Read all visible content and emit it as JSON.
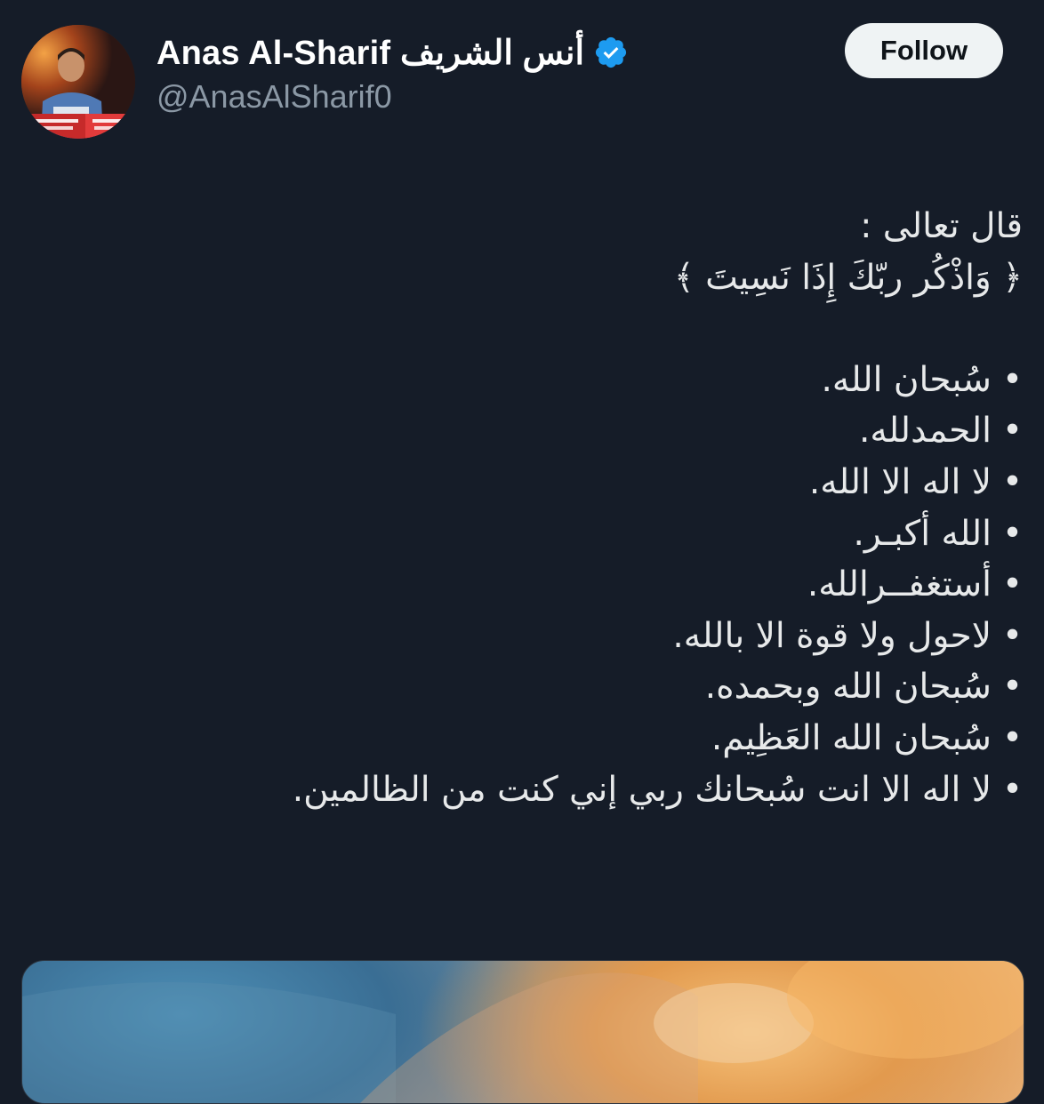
{
  "author": {
    "display_name": "Anas Al-Sharif أنس الشريف",
    "handle": "@AnasAlSharif0",
    "verified": true,
    "verified_icon": "verified-badge-icon",
    "verified_color": "#1d9bf0",
    "avatar": "profile-photo"
  },
  "actions": {
    "follow_label": "Follow"
  },
  "tweet": {
    "intro": "قال تعالى :",
    "verse": "﴿ وَاذْكُر ربّكَ إِذَا نَسِيتَ ﴾",
    "bullet_char": "•",
    "items": [
      "سُبحان الله.",
      "الحمدلله.",
      "لا اله الا الله.",
      "الله أكبـر.",
      "أستغفــرالله.",
      "لاحول ولا قوة الا بالله.",
      "سُبحان الله وبحمده.",
      "سُبحان الله العَظِيم.",
      "لا اله الا انت سُبحانك ربي إني كنت من الظالمين."
    ]
  },
  "media": {
    "type": "image",
    "description_icon": "media-thumbnail"
  },
  "colors": {
    "background": "#151c28",
    "text": "#e7e9ea",
    "secondary_text": "#8b98a5",
    "follow_bg": "#eff3f4"
  }
}
